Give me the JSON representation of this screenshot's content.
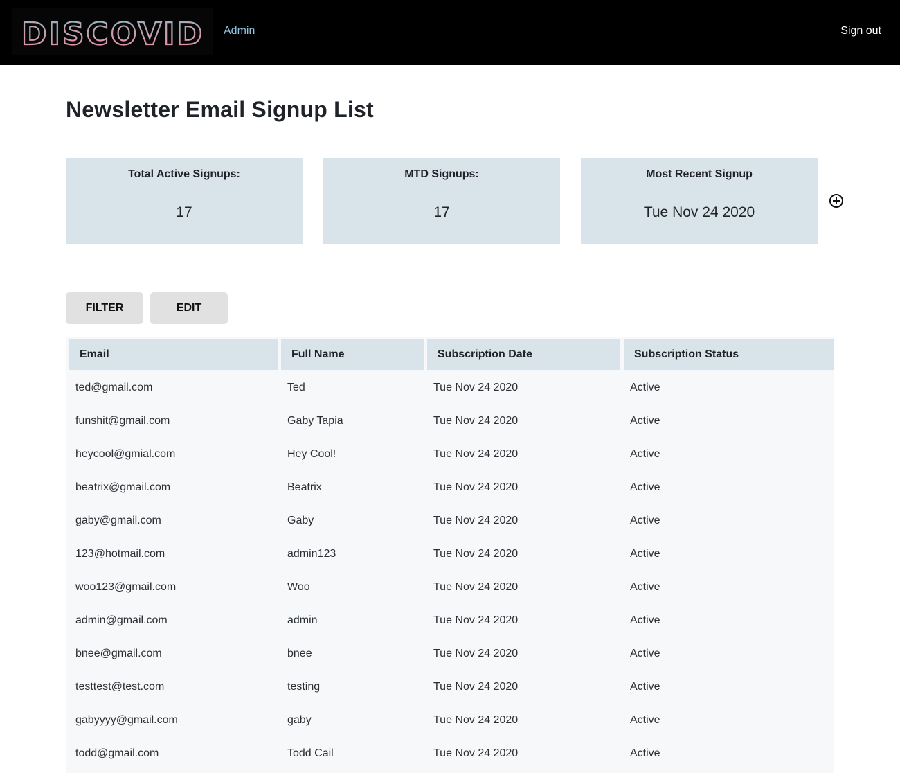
{
  "header": {
    "logo_text": "DISCOVID",
    "admin_label": "Admin",
    "signout_label": "Sign out"
  },
  "page": {
    "title": "Newsletter Email Signup List"
  },
  "stats": {
    "total_active": {
      "label": "Total Active Signups:",
      "value": "17"
    },
    "mtd": {
      "label": "MTD Signups:",
      "value": "17"
    },
    "most_recent": {
      "label": "Most Recent Signup",
      "value": "Tue Nov 24 2020"
    }
  },
  "icons": {
    "add": "plus-circle-icon"
  },
  "toolbar": {
    "filter_label": "FILTER",
    "edit_label": "EDIT"
  },
  "table": {
    "columns": [
      "Email",
      "Full Name",
      "Subscription Date",
      "Subscription Status"
    ],
    "rows": [
      [
        "ted@gmail.com",
        "Ted",
        "Tue Nov 24 2020",
        "Active"
      ],
      [
        "funshit@gmail.com",
        "Gaby Tapia",
        "Tue Nov 24 2020",
        "Active"
      ],
      [
        "heycool@gmial.com",
        "Hey Cool!",
        "Tue Nov 24 2020",
        "Active"
      ],
      [
        "beatrix@gmail.com",
        "Beatrix",
        "Tue Nov 24 2020",
        "Active"
      ],
      [
        "gaby@gmail.com",
        "Gaby",
        "Tue Nov 24 2020",
        "Active"
      ],
      [
        "123@hotmail.com",
        "admin123",
        "Tue Nov 24 2020",
        "Active"
      ],
      [
        "woo123@gmail.com",
        "Woo",
        "Tue Nov 24 2020",
        "Active"
      ],
      [
        "admin@gmail.com",
        "admin",
        "Tue Nov 24 2020",
        "Active"
      ],
      [
        "bnee@gmail.com",
        "bnee",
        "Tue Nov 24 2020",
        "Active"
      ],
      [
        "testtest@test.com",
        "testing",
        "Tue Nov 24 2020",
        "Active"
      ],
      [
        "gabyyyy@gmail.com",
        "gaby",
        "Tue Nov 24 2020",
        "Active"
      ],
      [
        "todd@gmail.com",
        "Todd Cail",
        "Tue Nov 24 2020",
        "Active"
      ]
    ]
  },
  "colors": {
    "header_bg": "#000000",
    "admin_link": "#8ec2de",
    "card_bg": "#d9e3ea",
    "table_bg": "#f6f8fa",
    "button_bg": "#e1e1e1",
    "logo_pink": "#f08ca0",
    "logo_teal": "#6fc3c6"
  }
}
